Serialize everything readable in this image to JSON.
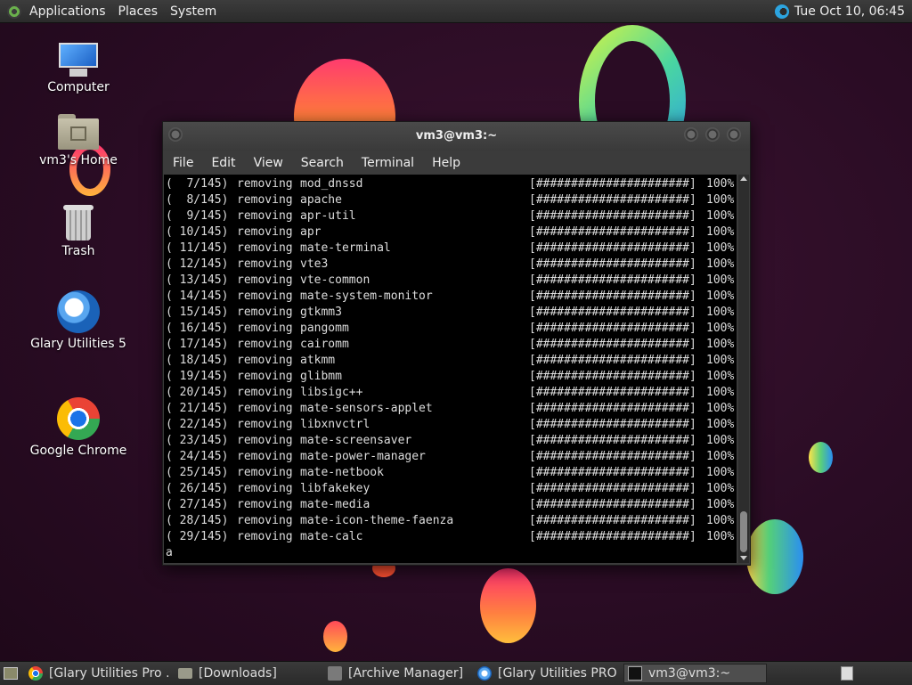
{
  "top_panel": {
    "menus": [
      "Applications",
      "Places",
      "System"
    ],
    "clock": "Tue Oct 10, 06:45"
  },
  "desktop_icons": [
    {
      "label": "Computer",
      "icon": "computer-icon"
    },
    {
      "label": "vm3's Home",
      "icon": "home-folder-icon"
    },
    {
      "label": "Trash",
      "icon": "trash-icon"
    },
    {
      "label": "Glary Utilities 5",
      "icon": "glary-utilities-icon"
    },
    {
      "label": "Google Chrome",
      "icon": "chrome-icon"
    }
  ],
  "terminal": {
    "title": "vm3@vm3:~",
    "menus": [
      "File",
      "Edit",
      "View",
      "Search",
      "Terminal",
      "Help"
    ],
    "progress_bar": "[######################]",
    "lines": [
      {
        "num": "(  7/145)",
        "action": "removing",
        "pkg": "mod_dnssd",
        "pct": "100%"
      },
      {
        "num": "(  8/145)",
        "action": "removing",
        "pkg": "apache",
        "pct": "100%"
      },
      {
        "num": "(  9/145)",
        "action": "removing",
        "pkg": "apr-util",
        "pct": "100%"
      },
      {
        "num": "( 10/145)",
        "action": "removing",
        "pkg": "apr",
        "pct": "100%"
      },
      {
        "num": "( 11/145)",
        "action": "removing",
        "pkg": "mate-terminal",
        "pct": "100%"
      },
      {
        "num": "( 12/145)",
        "action": "removing",
        "pkg": "vte3",
        "pct": "100%"
      },
      {
        "num": "( 13/145)",
        "action": "removing",
        "pkg": "vte-common",
        "pct": "100%"
      },
      {
        "num": "( 14/145)",
        "action": "removing",
        "pkg": "mate-system-monitor",
        "pct": "100%"
      },
      {
        "num": "( 15/145)",
        "action": "removing",
        "pkg": "gtkmm3",
        "pct": "100%"
      },
      {
        "num": "( 16/145)",
        "action": "removing",
        "pkg": "pangomm",
        "pct": "100%"
      },
      {
        "num": "( 17/145)",
        "action": "removing",
        "pkg": "cairomm",
        "pct": "100%"
      },
      {
        "num": "( 18/145)",
        "action": "removing",
        "pkg": "atkmm",
        "pct": "100%"
      },
      {
        "num": "( 19/145)",
        "action": "removing",
        "pkg": "glibmm",
        "pct": "100%"
      },
      {
        "num": "( 20/145)",
        "action": "removing",
        "pkg": "libsigc++",
        "pct": "100%"
      },
      {
        "num": "( 21/145)",
        "action": "removing",
        "pkg": "mate-sensors-applet",
        "pct": "100%"
      },
      {
        "num": "( 22/145)",
        "action": "removing",
        "pkg": "libxnvctrl",
        "pct": "100%"
      },
      {
        "num": "( 23/145)",
        "action": "removing",
        "pkg": "mate-screensaver",
        "pct": "100%"
      },
      {
        "num": "( 24/145)",
        "action": "removing",
        "pkg": "mate-power-manager",
        "pct": "100%"
      },
      {
        "num": "( 25/145)",
        "action": "removing",
        "pkg": "mate-netbook",
        "pct": "100%"
      },
      {
        "num": "( 26/145)",
        "action": "removing",
        "pkg": "libfakekey",
        "pct": "100%"
      },
      {
        "num": "( 27/145)",
        "action": "removing",
        "pkg": "mate-media",
        "pct": "100%"
      },
      {
        "num": "( 28/145)",
        "action": "removing",
        "pkg": "mate-icon-theme-faenza",
        "pct": "100%"
      },
      {
        "num": "( 29/145)",
        "action": "removing",
        "pkg": "mate-calc",
        "pct": "100%"
      }
    ],
    "prompt_line": "a"
  },
  "taskbar": {
    "tasks": [
      {
        "label": "[Glary Utilities Pro ...",
        "icon": "chrome-icon",
        "active": false
      },
      {
        "label": "[Downloads]",
        "icon": "folder-icon",
        "active": false
      },
      {
        "label": "[Archive Manager]",
        "icon": "archive-icon",
        "active": false
      },
      {
        "label": "[Glary Utilities PRO]",
        "icon": "glary-utilities-icon",
        "active": false
      },
      {
        "label": "vm3@vm3:~",
        "icon": "terminal-icon",
        "active": true
      }
    ]
  }
}
